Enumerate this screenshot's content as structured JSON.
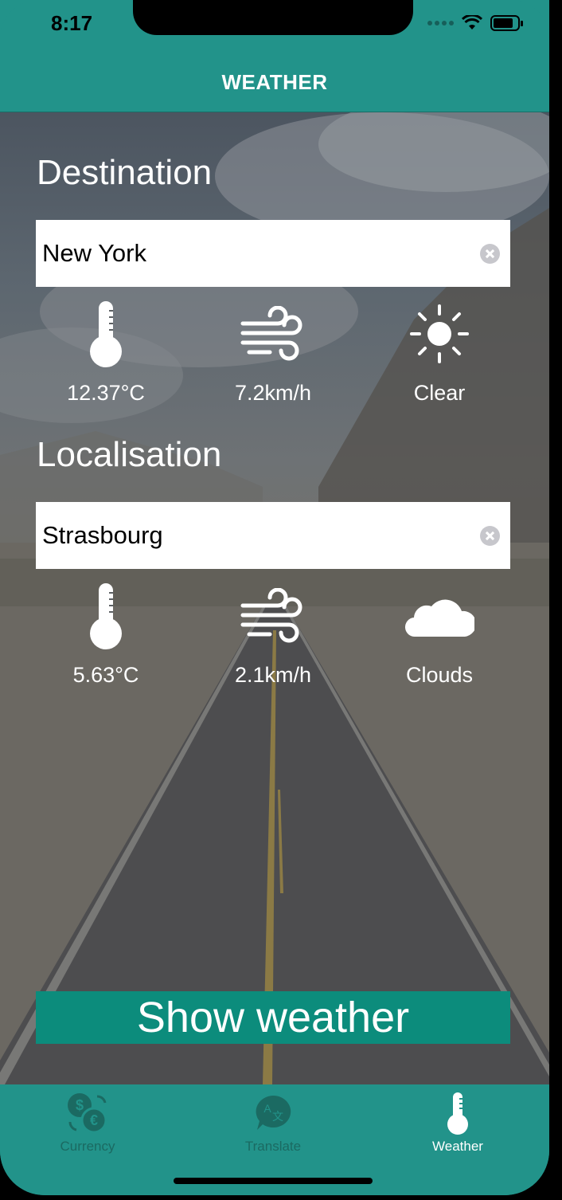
{
  "status_bar": {
    "time": "8:17",
    "icons": [
      "signal-dots-icon",
      "wifi-icon",
      "battery-icon"
    ]
  },
  "nav": {
    "title": "WEATHER"
  },
  "destination": {
    "title": "Destination",
    "city": "New York",
    "temperature": "12.37°C",
    "wind": "7.2km/h",
    "condition": "Clear",
    "condition_icon": "sun-icon"
  },
  "localisation": {
    "title": "Localisation",
    "city": "Strasbourg",
    "temperature": "5.63°C",
    "wind": "2.1km/h",
    "condition": "Clouds",
    "condition_icon": "cloud-icon"
  },
  "action": {
    "show_label": "Show weather"
  },
  "tabs": [
    {
      "label": "Currency",
      "icon": "currency-exchange-icon",
      "active": false
    },
    {
      "label": "Translate",
      "icon": "translate-icon",
      "active": false
    },
    {
      "label": "Weather",
      "icon": "thermometer-icon",
      "active": true
    }
  ],
  "colors": {
    "accent": "#22938A",
    "button": "#0C8C7C",
    "inactive_tab": "#1B6A62"
  }
}
